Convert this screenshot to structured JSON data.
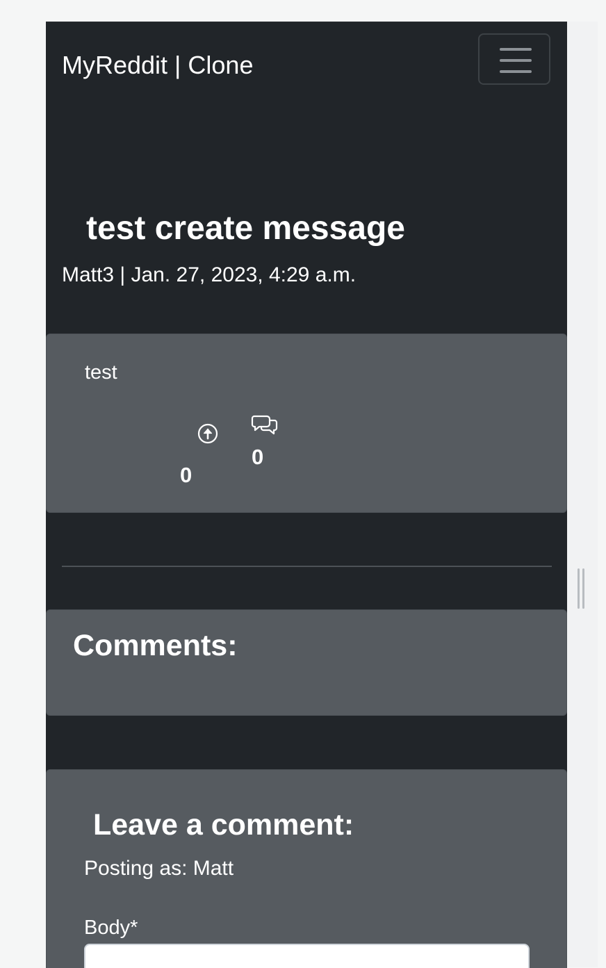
{
  "navbar": {
    "brand": "MyReddit | Clone",
    "toggle_icon": "hamburger-menu-icon"
  },
  "post": {
    "title": "test create message",
    "meta": "Matt3 | Jan. 27, 2023, 4:29 a.m.",
    "body": "test",
    "upvote_icon": "arrow-up-circle-icon",
    "upvote_count": "0",
    "comment_icon": "chat-bubbles-icon",
    "comment_count": "0"
  },
  "comments": {
    "heading": "Comments:"
  },
  "comment_form": {
    "heading": "Leave a comment:",
    "posting_as": "Posting as: Matt",
    "body_label": "Body*",
    "body_value": ""
  },
  "colors": {
    "page_bg": "#212529",
    "card_bg": "#565b60",
    "text": "#ffffff"
  }
}
